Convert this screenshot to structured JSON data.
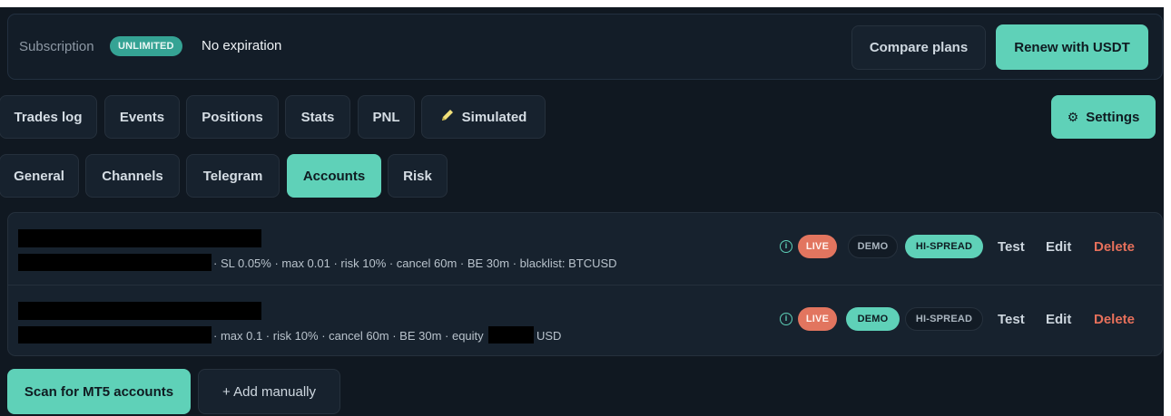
{
  "subscription": {
    "label": "Subscription",
    "badge": "UNLIMITED",
    "value": "No expiration",
    "compare_label": "Compare plans",
    "renew_label": "Renew with USDT"
  },
  "main_tabs": [
    {
      "label": "Trades log",
      "active": false
    },
    {
      "label": "Events",
      "active": false
    },
    {
      "label": "Positions",
      "active": false
    },
    {
      "label": "Stats",
      "active": false
    },
    {
      "label": "PNL",
      "active": false
    },
    {
      "label": "Simulated",
      "active": false,
      "icon": "pencil-icon"
    }
  ],
  "settings_button": {
    "label": "Settings",
    "icon": "gear-icon"
  },
  "settings_tabs": [
    {
      "label": "General",
      "active": false
    },
    {
      "label": "Channels",
      "active": false
    },
    {
      "label": "Telegram",
      "active": false
    },
    {
      "label": "Accounts",
      "active": true
    },
    {
      "label": "Risk",
      "active": false
    }
  ],
  "accounts": [
    {
      "meta": "· SL 0.05% · max 0.01 · risk 10% · cancel 60m · BE 30m · blacklist: BTCUSD",
      "live": "LIVE",
      "demo": "DEMO",
      "demo_active": false,
      "hispread": "HI-SPREAD",
      "hispread_active": true,
      "test_label": "Test",
      "edit_label": "Edit",
      "delete_label": "Delete"
    },
    {
      "meta": "· max 0.1 · risk 10% · cancel 60m · BE 30m · equity",
      "meta_suffix": "USD",
      "live": "LIVE",
      "demo": "DEMO",
      "demo_active": true,
      "hispread": "HI-SPREAD",
      "hispread_active": false,
      "test_label": "Test",
      "edit_label": "Edit",
      "delete_label": "Delete"
    }
  ],
  "footer": {
    "scan_label": "Scan for MT5 accounts",
    "add_label": "+ Add manually"
  },
  "colors": {
    "background": "#101821",
    "accent": "#5fd1b8",
    "live": "#e2755f",
    "delete": "#e6705b"
  }
}
